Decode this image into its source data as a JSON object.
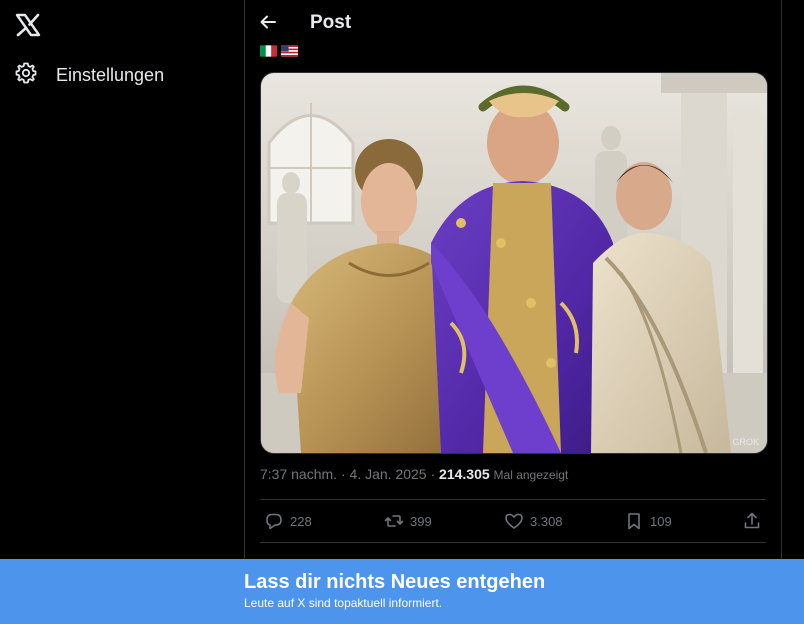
{
  "nav": {
    "logo_icon": "x-logo-icon",
    "settings_label": "Einstellungen",
    "settings_icon": "gear-icon"
  },
  "header": {
    "back_icon": "arrow-left-icon",
    "title": "Post"
  },
  "post": {
    "flags": [
      "italy-flag-icon",
      "usa-flag-icon"
    ],
    "image_watermark": "GROK",
    "time": "7:37 nachm.",
    "separator": "·",
    "date": "4. Jan. 2025",
    "views_count": "214.305",
    "views_label": "Mal angezeigt",
    "stats": {
      "replies": "228",
      "reposts": "399",
      "likes": "3.308",
      "bookmarks": "109"
    }
  },
  "banner": {
    "title": "Lass dir nichts Neues entgehen",
    "subtitle": "Leute auf X sind topaktuell informiert."
  },
  "colors": {
    "background": "#000000",
    "text_primary": "#e7e9ea",
    "text_secondary": "#71767b",
    "border": "#2f3336",
    "banner": "#4d95ec"
  }
}
